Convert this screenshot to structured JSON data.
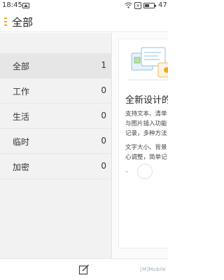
{
  "status": {
    "time": "18:45",
    "battery_level": "47"
  },
  "header": {
    "title": "全部"
  },
  "sidebar": {
    "items": [
      {
        "label": "全部",
        "count": "1"
      },
      {
        "label": "工作",
        "count": "0"
      },
      {
        "label": "生活",
        "count": "0"
      },
      {
        "label": "临时",
        "count": "0"
      },
      {
        "label": "加密",
        "count": "0"
      }
    ]
  },
  "note": {
    "title": "全新设计的",
    "body_lines": [
      "支持文本、清单",
      "与图片插入功能",
      "记录，多种方法",
      "文字大小、背景",
      "心调整，简单记"
    ]
  },
  "bottom": {
    "brand": "[M]Mobile"
  },
  "colors": {
    "accent": "#f5a623",
    "sidebar_bg": "#f2f2f2",
    "active_item_bg": "#e6e6e6"
  }
}
